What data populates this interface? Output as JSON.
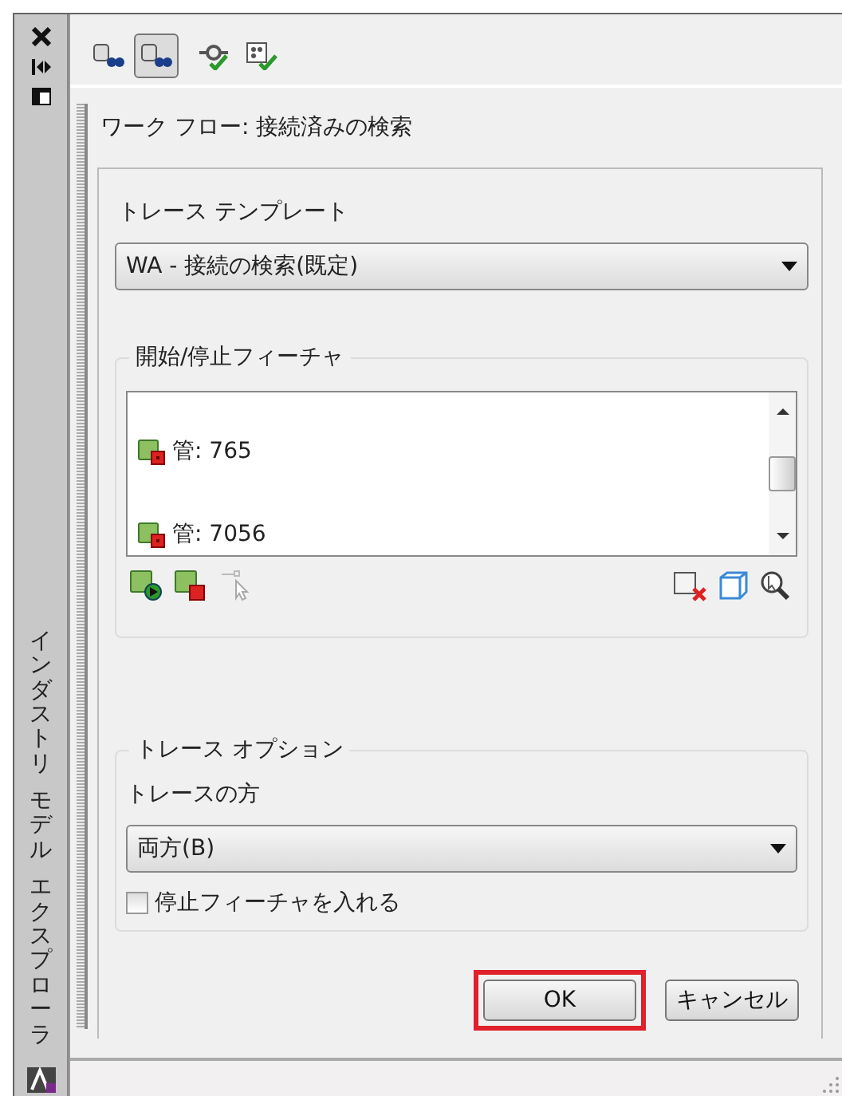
{
  "side_bar": {
    "title": [
      "インダストリ",
      "モデル",
      "エクスプローラ"
    ]
  },
  "toolbar": {
    "tools": [
      {
        "selected": false
      },
      {
        "selected": true
      },
      {
        "selected": false
      },
      {
        "selected": false
      }
    ]
  },
  "header": "ワーク フロー: 接続済みの検索",
  "trace_template": {
    "label": "トレース テンプレート",
    "value": "WA - 接続の検索(既定)"
  },
  "start_stop": {
    "title": "開始/停止フィーチャ",
    "items": [
      {
        "label": "管: 765"
      },
      {
        "label": "管: 7056"
      }
    ]
  },
  "trace_options": {
    "title": "トレース オプション",
    "direction_label": "トレースの方",
    "direction": "両方(B)",
    "include_stop": {
      "label": "停止フィーチャを入れる",
      "checked": false
    }
  },
  "buttons": [
    {
      "label": "OK",
      "highlighted": true
    },
    {
      "label": "キャンセル",
      "highlighted": false
    }
  ]
}
